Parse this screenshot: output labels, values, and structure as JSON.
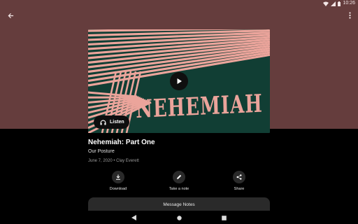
{
  "status_bar": {
    "time": "10:26"
  },
  "colors": {
    "hero_background": "#653d3d",
    "artwork_background": "#113e34",
    "artwork_accent": "#eba49b"
  },
  "artwork": {
    "title": "NEHEMIAH"
  },
  "player": {
    "listen_label": "Listen"
  },
  "sermon": {
    "title": "Nehemiah: Part One",
    "series": "Our Posture",
    "meta": "June 7, 2020 • Clay Everett"
  },
  "actions": {
    "download_label": "Download",
    "note_label": "Take a note",
    "share_label": "Share"
  },
  "notes": {
    "label": "Message Notes"
  },
  "icons": [
    "back-arrow-icon",
    "more-vert-icon",
    "play-icon",
    "headphones-icon",
    "download-icon",
    "pencil-icon",
    "share-icon",
    "nav-back-icon",
    "nav-home-icon",
    "nav-recents-icon",
    "wifi-icon",
    "signal-icon",
    "battery-icon"
  ]
}
